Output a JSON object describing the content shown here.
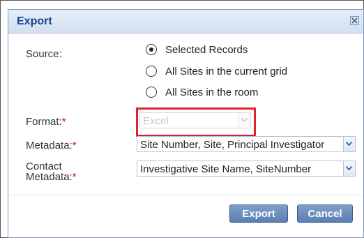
{
  "dialog": {
    "title": "Export",
    "close_icon": "close-icon"
  },
  "source": {
    "label": "Source:",
    "options": [
      {
        "label": "Selected Records",
        "checked": true
      },
      {
        "label": "All Sites in the current grid",
        "checked": false
      },
      {
        "label": "All Sites in the room",
        "checked": false
      }
    ]
  },
  "format": {
    "label": "Format:",
    "required": "*",
    "value": "Excel",
    "disabled": true
  },
  "metadata": {
    "label": "Metadata:",
    "required": "*",
    "value": "Site Number, Site, Principal Investigator"
  },
  "contact_metadata": {
    "label_line1": "Contact",
    "label_line2": "Metadata:",
    "required": "*",
    "value": "Investigative Site Name, SiteNumber"
  },
  "buttons": {
    "export": "Export",
    "cancel": "Cancel"
  },
  "colors": {
    "title": "#15428b",
    "highlight": "#e0212b",
    "button": "#5a7fb3",
    "required": "#dd0000"
  }
}
